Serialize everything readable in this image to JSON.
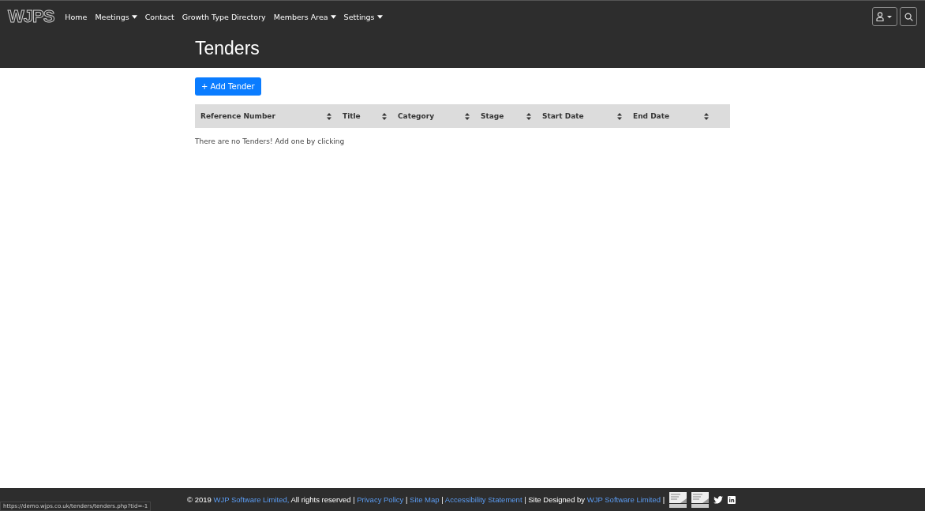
{
  "navbar": {
    "logo": "WJPS",
    "items": [
      {
        "label": "Home",
        "dropdown": false
      },
      {
        "label": "Meetings",
        "dropdown": true
      },
      {
        "label": "Contact",
        "dropdown": false
      },
      {
        "label": "Growth Type Directory",
        "dropdown": false
      },
      {
        "label": "Members Area",
        "dropdown": true
      },
      {
        "label": "Settings",
        "dropdown": true
      }
    ]
  },
  "page_title": "Tenders",
  "add_button": "+ Add Tender",
  "table": {
    "columns": [
      "Reference Number",
      "Title",
      "Category",
      "Stage",
      "Start Date",
      "End Date"
    ]
  },
  "empty_message": "There are no Tenders! Add one by clicking",
  "footer": {
    "parts": [
      {
        "kind": "text",
        "text": "© 2019 "
      },
      {
        "kind": "link",
        "text": "WJP Software Limited,"
      },
      {
        "kind": "text",
        "text": " All rights reserved | "
      },
      {
        "kind": "link",
        "text": "Privacy Policy"
      },
      {
        "kind": "text",
        "text": " | "
      },
      {
        "kind": "link",
        "text": "Site Map"
      },
      {
        "kind": "text",
        "text": " | "
      },
      {
        "kind": "link",
        "text": "Accessibility Statement"
      },
      {
        "kind": "text",
        "text": " | Site Designed by "
      },
      {
        "kind": "link",
        "text": "WJP Software Limited"
      },
      {
        "kind": "text",
        "text": " |"
      }
    ]
  },
  "status_url": "https://demo.wjps.co.uk/tenders/tenders.php?tid=-1"
}
